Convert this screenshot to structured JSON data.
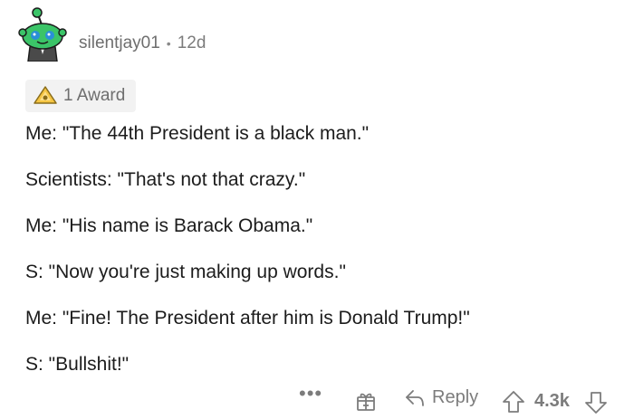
{
  "comment": {
    "author": "silentjay01",
    "separator": "•",
    "age": "12d",
    "award": "1 Award",
    "lines": [
      "Me: \"The 44th President is a black man.\"",
      "Scientists: \"That's not that crazy.\"",
      "Me: \"His name is Barack Obama.\"",
      "S: \"Now you're just making up words.\"",
      "Me: \"Fine! The President after him is Donald Trump!\"",
      "S: \"Bullshit!\""
    ]
  },
  "actions": {
    "more": "•••",
    "reply": "Reply",
    "score": "4.3k"
  },
  "colors": {
    "avatar_green": "#3bc468",
    "award_bg": "#f2f2f2",
    "meta_text": "#7c7c7c",
    "body_text": "#1c1c1c"
  },
  "icons": [
    "reddit-snoo-avatar-icon",
    "award-icon",
    "gift-icon",
    "reply-arrow-icon",
    "upvote-arrow-icon",
    "downvote-arrow-icon"
  ]
}
